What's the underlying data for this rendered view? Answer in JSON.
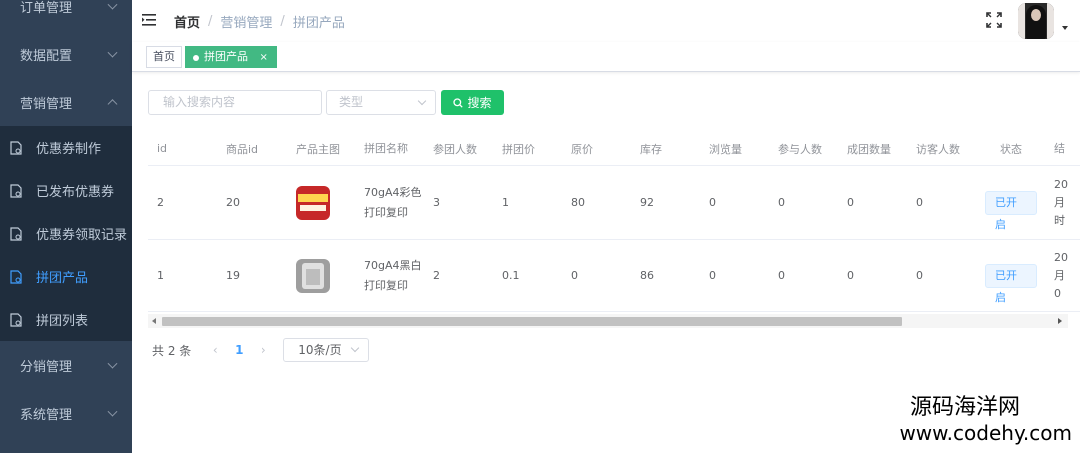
{
  "sidebar": {
    "items": [
      {
        "label": "订单管理"
      },
      {
        "label": "数据配置"
      },
      {
        "label": "营销管理"
      },
      {
        "label": "分销管理"
      },
      {
        "label": "系统管理"
      }
    ],
    "submenu": [
      {
        "label": "优惠券制作"
      },
      {
        "label": "已发布优惠券"
      },
      {
        "label": "优惠券领取记录"
      },
      {
        "label": "拼团产品"
      },
      {
        "label": "拼团列表"
      }
    ]
  },
  "header": {
    "breadcrumb": [
      "首页",
      "营销管理",
      "拼团产品"
    ]
  },
  "tags": {
    "home": "首页",
    "active": "拼团产品",
    "close": "×"
  },
  "filter": {
    "search_placeholder": "输入搜索内容",
    "type_placeholder": "类型",
    "search_button": "搜索"
  },
  "table": {
    "columns": [
      "id",
      "商品id",
      "产品主图",
      "拼团名称",
      "参团人数",
      "拼团价",
      "原价",
      "库存",
      "浏览量",
      "参与人数",
      "成团数量",
      "访客人数",
      "状态",
      "结"
    ],
    "rows": [
      {
        "id": "2",
        "product_id": "20",
        "name": "70gA4彩色打印复印",
        "group_size": "3",
        "group_price": "1",
        "original_price": "80",
        "stock": "92",
        "views": "0",
        "participants": "0",
        "groups": "0",
        "visitors": "0",
        "status": "已开启",
        "end_time": "20月时"
      },
      {
        "id": "1",
        "product_id": "19",
        "name": "70gA4黑白打印复印",
        "group_size": "2",
        "group_price": "0.1",
        "original_price": "0",
        "stock": "86",
        "views": "0",
        "participants": "0",
        "groups": "0",
        "visitors": "0",
        "status": "已开启",
        "end_time": "20月0"
      }
    ]
  },
  "pagination": {
    "total": "共 2 条",
    "prev": "‹",
    "current_page": "1",
    "next": "›",
    "page_size": "10条/页"
  },
  "watermark": {
    "name": "源码海洋网",
    "url": "www.codehy.com"
  },
  "colors": {
    "sidebar_bg": "#304156",
    "submenu_bg": "#1f2d3d",
    "active_tag": "#42b983",
    "search_button": "#1fc16a",
    "link": "#409eff"
  },
  "icons": [
    "hamburger-icon",
    "fullscreen-icon",
    "search-icon",
    "document-icon",
    "chevron-down-icon",
    "chevron-up-icon"
  ]
}
